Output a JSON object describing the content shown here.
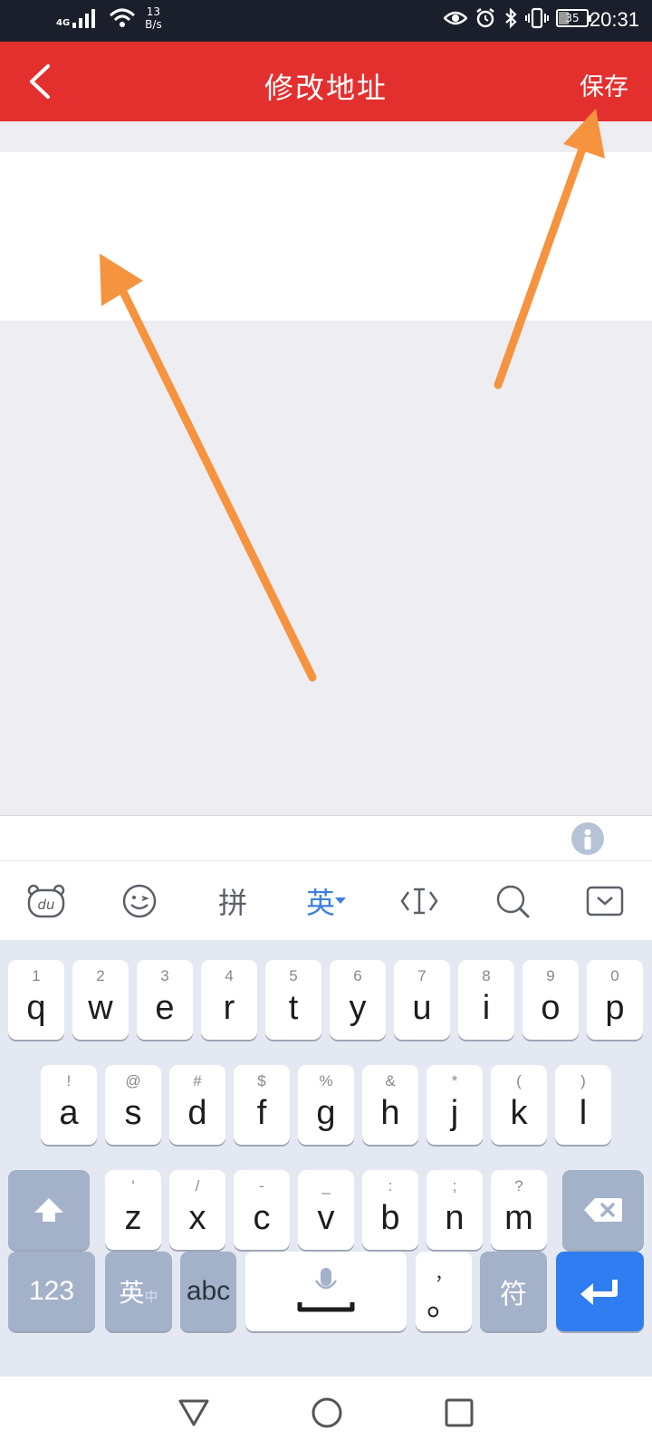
{
  "status_bar": {
    "network_type": "4G",
    "net_speed_value": "13",
    "net_speed_unit": "B/s",
    "battery_level": "35",
    "time": "20:31"
  },
  "app_bar": {
    "title": "修改地址",
    "save_label": "保存"
  },
  "address_input": {
    "value": "",
    "placeholder": ""
  },
  "keyboard": {
    "toolbar": {
      "pinyin_label": "拼",
      "english_label": "英"
    },
    "row1": [
      {
        "sub": "1",
        "key": "q"
      },
      {
        "sub": "2",
        "key": "w"
      },
      {
        "sub": "3",
        "key": "e"
      },
      {
        "sub": "4",
        "key": "r"
      },
      {
        "sub": "5",
        "key": "t"
      },
      {
        "sub": "6",
        "key": "y"
      },
      {
        "sub": "7",
        "key": "u"
      },
      {
        "sub": "8",
        "key": "i"
      },
      {
        "sub": "9",
        "key": "o"
      },
      {
        "sub": "0",
        "key": "p"
      }
    ],
    "row2": [
      {
        "sub": "!",
        "key": "a"
      },
      {
        "sub": "@",
        "key": "s"
      },
      {
        "sub": "#",
        "key": "d"
      },
      {
        "sub": "$",
        "key": "f"
      },
      {
        "sub": "%",
        "key": "g"
      },
      {
        "sub": "&",
        "key": "h"
      },
      {
        "sub": "*",
        "key": "j"
      },
      {
        "sub": "(",
        "key": "k"
      },
      {
        "sub": ")",
        "key": "l"
      }
    ],
    "row3": [
      {
        "sub": "'",
        "key": "z"
      },
      {
        "sub": "/",
        "key": "x"
      },
      {
        "sub": "-",
        "key": "c"
      },
      {
        "sub": "_",
        "key": "v"
      },
      {
        "sub": ":",
        "key": "b"
      },
      {
        "sub": ";",
        "key": "n"
      },
      {
        "sub": "?",
        "key": "m"
      }
    ],
    "bottom": {
      "num_label": "123",
      "lang_label": "英",
      "lang_sub": "中",
      "abc_label": "abc",
      "comma_sub": "，",
      "period_label": "。",
      "symbol_label": "符"
    }
  },
  "colors": {
    "app_bar": "#e3302f",
    "status_bar": "#1b1f2b",
    "annotation_arrow": "#f5933f",
    "keyboard_bg": "#e4e8f2",
    "enter_key": "#2f7df0",
    "accent_blue": "#3d7fe0"
  }
}
